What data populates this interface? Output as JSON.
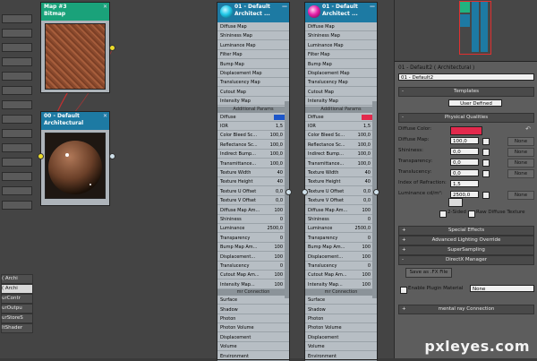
{
  "left_strip": {
    "items": [
      "( Archi",
      "( Archi",
      "urContr",
      "urOutpu",
      "urStoreS",
      "ltShader"
    ],
    "selected_index": 1
  },
  "nodes": {
    "bitmap": {
      "title": "Map #3",
      "subtitle": "Bitmap",
      "color": "#1aa27a"
    },
    "arch_node": {
      "title": "00 - Default",
      "subtitle": "Architectural",
      "color": "#1d7aa3"
    },
    "mat1": {
      "title": "01 - Default",
      "subtitle": "Architect ...",
      "color": "#1d7aa3",
      "ball": "#1fc8e8"
    },
    "mat2": {
      "title": "01 - Default",
      "subtitle": "Architect ...",
      "color": "#1d7aa3",
      "ball": "#e61fa9"
    }
  },
  "slots_top": [
    "Diffuse Map",
    "Shininess Map",
    "Luminance Map",
    "Filter Map",
    "Bump Map",
    "Displacement Map",
    "Translucency Map",
    "Cutout Map",
    "Intensity Map"
  ],
  "slots_top_mat2": [
    "Diffuse Map",
    "Shininess Map",
    "Luminance Map",
    "Filter Map",
    "Bump Map",
    "Displacement Map",
    "Translucency Map",
    "Cutout Map",
    "Intensity Map"
  ],
  "additional_header": "Additional Params",
  "params": [
    {
      "label": "Diffuse",
      "value": ""
    },
    {
      "label": "IOR",
      "value": "1,5"
    },
    {
      "label": "Color Bleed Sc...",
      "value": "100,0"
    },
    {
      "label": "Reflectance Sc...",
      "value": "100,0"
    },
    {
      "label": "Indirect Bump...",
      "value": "100,0"
    },
    {
      "label": "Transmittance...",
      "value": "100,0"
    },
    {
      "label": "Texture Width",
      "value": "40"
    },
    {
      "label": "Texture Height",
      "value": "40"
    },
    {
      "label": "Texture U Offset",
      "value": "0,0"
    },
    {
      "label": "Texture V Offset",
      "value": "0,0"
    },
    {
      "label": "Diffuse Map Am...",
      "value": "100"
    },
    {
      "label": "Shininess",
      "value": "0"
    },
    {
      "label": "Luminance",
      "value": "2500,0"
    },
    {
      "label": "Transparency",
      "value": "0"
    },
    {
      "label": "Bump Map Am...",
      "value": "100"
    },
    {
      "label": "Displacement...",
      "value": "100"
    },
    {
      "label": "Translucency",
      "value": "0"
    },
    {
      "label": "Cutout Map Am...",
      "value": "100"
    },
    {
      "label": "Intensity Map...",
      "value": "100"
    }
  ],
  "params_mat2": [
    {
      "label": "Diffuse",
      "value": ""
    },
    {
      "label": "IOR",
      "value": "1,5"
    },
    {
      "label": "Color Bleed Sc...",
      "value": "100,0"
    },
    {
      "label": "Reflectance Sc...",
      "value": "100,0"
    },
    {
      "label": "Indirect Bump...",
      "value": "100,0"
    },
    {
      "label": "Transmittance...",
      "value": "100,0"
    },
    {
      "label": "Texture Width",
      "value": "40"
    },
    {
      "label": "Texture Height",
      "value": "40"
    },
    {
      "label": "Texture U Offset",
      "value": "0,0"
    },
    {
      "label": "Texture V Offset",
      "value": "0,0"
    },
    {
      "label": "Diffuse Map Am...",
      "value": "100"
    },
    {
      "label": "Shininess",
      "value": "0"
    },
    {
      "label": "Luminance",
      "value": "2500,0"
    },
    {
      "label": "Transparency",
      "value": "0"
    },
    {
      "label": "Bump Map Am...",
      "value": "100"
    },
    {
      "label": "Displacement...",
      "value": "100"
    },
    {
      "label": "Translucency",
      "value": "0"
    },
    {
      "label": "Cutout Map Am...",
      "value": "100"
    },
    {
      "label": "Intensity Map...",
      "value": "100"
    }
  ],
  "mr_header": "mr Connection",
  "mr_slots": [
    "Surface",
    "Shadow",
    "Photon",
    "Photon Volume",
    "Displacement",
    "Volume",
    "Environment"
  ],
  "mr_slots_mat2": [
    "Surface",
    "Shadow",
    "Photon",
    "Photon Volume",
    "Displacement",
    "Volume",
    "Environment"
  ],
  "diffuse_swatch_colors": [
    "#1d56c9",
    "#e2294c"
  ],
  "panel": {
    "title_field": "01 - Default2 ( Architectural )",
    "name_field": "01 - Default2",
    "templates_label": "Templates",
    "templates_value": "User Defined",
    "physical_label": "Physical Qualities",
    "diffuse_color_label": "Diffuse Color:",
    "diffuse_color": "#e2294c",
    "rows": [
      {
        "label": "Diffuse Map:",
        "value": "100,0",
        "btn": "None"
      },
      {
        "label": "Shininess:",
        "value": "0,0",
        "btn": "None"
      },
      {
        "label": "Transparency:",
        "value": "0,0",
        "btn": "None"
      },
      {
        "label": "Translucency:",
        "value": "0,0",
        "btn": "None"
      },
      {
        "label": "Index of Refraction:",
        "value": "1,5",
        "btn": ""
      },
      {
        "label": "Luminance cd/m²:",
        "value": "2500,0",
        "btn": "None"
      }
    ],
    "two_sided": "2-Sided",
    "raw_diffuse": "Raw Diffuse Texture",
    "rollouts": [
      "Special Effects",
      "Advanced Lighting Override",
      "SuperSampling",
      "DirectX Manager"
    ],
    "save_fx": "Save as .FX File",
    "enable_plugin": "Enable Plugin Material",
    "plugin_value": "None",
    "mental_ray": "mental ray Connection"
  },
  "watermark": "pxleyes.com"
}
